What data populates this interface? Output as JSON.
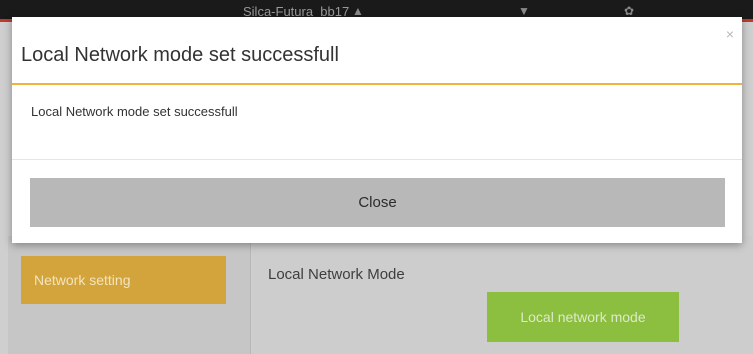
{
  "topbar": {
    "device_name": "Silca-Futura_bb17",
    "icons": [
      "home-icon",
      "settings-icon",
      "gear-icon"
    ]
  },
  "sidebar": {
    "button_label": "Network setting"
  },
  "main": {
    "section_title": "Local Network Mode",
    "mode_button_label": "Local network mode"
  },
  "modal": {
    "title": "Local Network mode set successfull",
    "message": "Local Network mode set successfull",
    "close_x": "×",
    "close_button_label": "Close"
  },
  "colors": {
    "accent": "#f0b43b",
    "sidebar_button": "#d3a43b",
    "mode_button": "#8cbf3f",
    "topbar": "#1a1a1a",
    "topbar_border": "#c0392b"
  }
}
